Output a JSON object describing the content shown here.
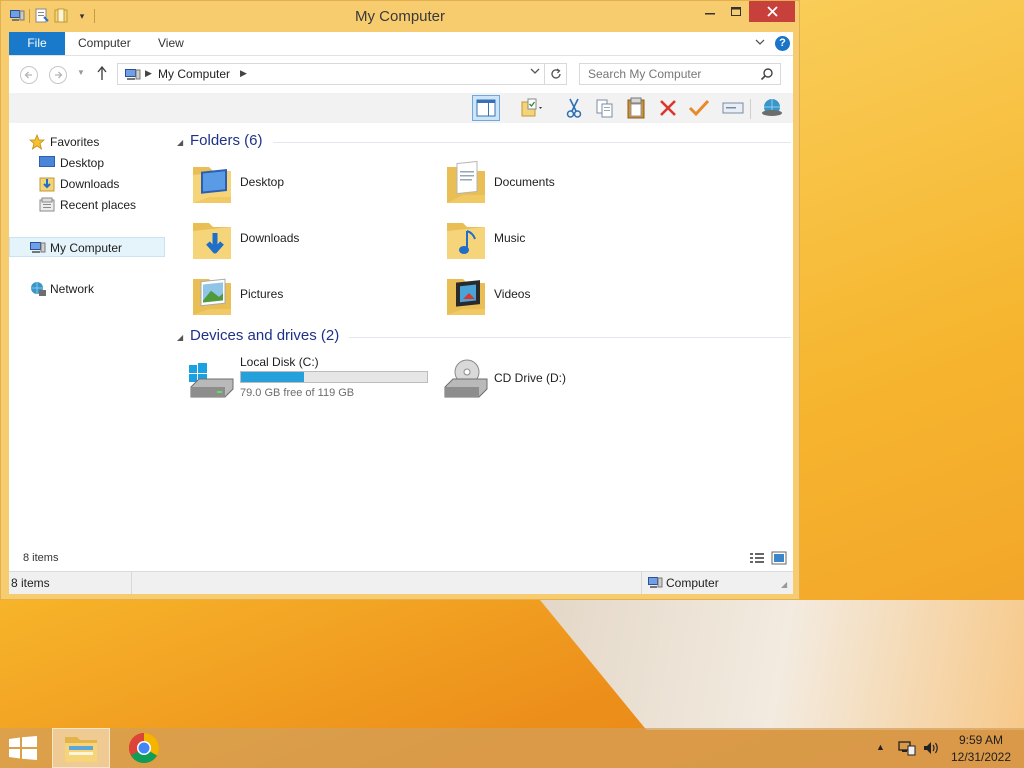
{
  "window": {
    "title": "My Computer",
    "controls": {
      "minimize": "–",
      "maximize": "□",
      "close": "✕"
    }
  },
  "ribbon": {
    "tabs": [
      {
        "label": "File",
        "active": true
      },
      {
        "label": "Computer"
      },
      {
        "label": "View"
      }
    ],
    "help": "?"
  },
  "address": {
    "path": "My Computer",
    "search_placeholder": "Search My Computer"
  },
  "toolbar": {
    "buttons": [
      "preview-pane",
      "properties",
      "cut",
      "copy",
      "paste",
      "delete",
      "rename",
      "map-drive",
      "network"
    ]
  },
  "navigation": {
    "favorites": {
      "label": "Favorites",
      "items": [
        "Desktop",
        "Downloads",
        "Recent places"
      ]
    },
    "computer": "My Computer",
    "network": "Network"
  },
  "folders": {
    "title": "Folders (6)",
    "items": [
      {
        "name": "Desktop"
      },
      {
        "name": "Documents"
      },
      {
        "name": "Downloads"
      },
      {
        "name": "Music"
      },
      {
        "name": "Pictures"
      },
      {
        "name": "Videos"
      }
    ]
  },
  "drives": {
    "title": "Devices and drives (2)",
    "items": [
      {
        "name": "Local Disk (C:)",
        "free_text": "79.0 GB free of 119 GB",
        "used_fraction": 0.34
      },
      {
        "name": "CD Drive (D:)"
      }
    ]
  },
  "status": {
    "inner_count": "8 items",
    "count": "8 items",
    "location": "Computer"
  },
  "taskbar": {
    "time": "9:59 AM",
    "date": "12/31/2022"
  },
  "colors": {
    "accent": "#1979ca",
    "close": "#c7403c",
    "drive_bar": "#26a0da",
    "group_title": "#1e3287"
  }
}
